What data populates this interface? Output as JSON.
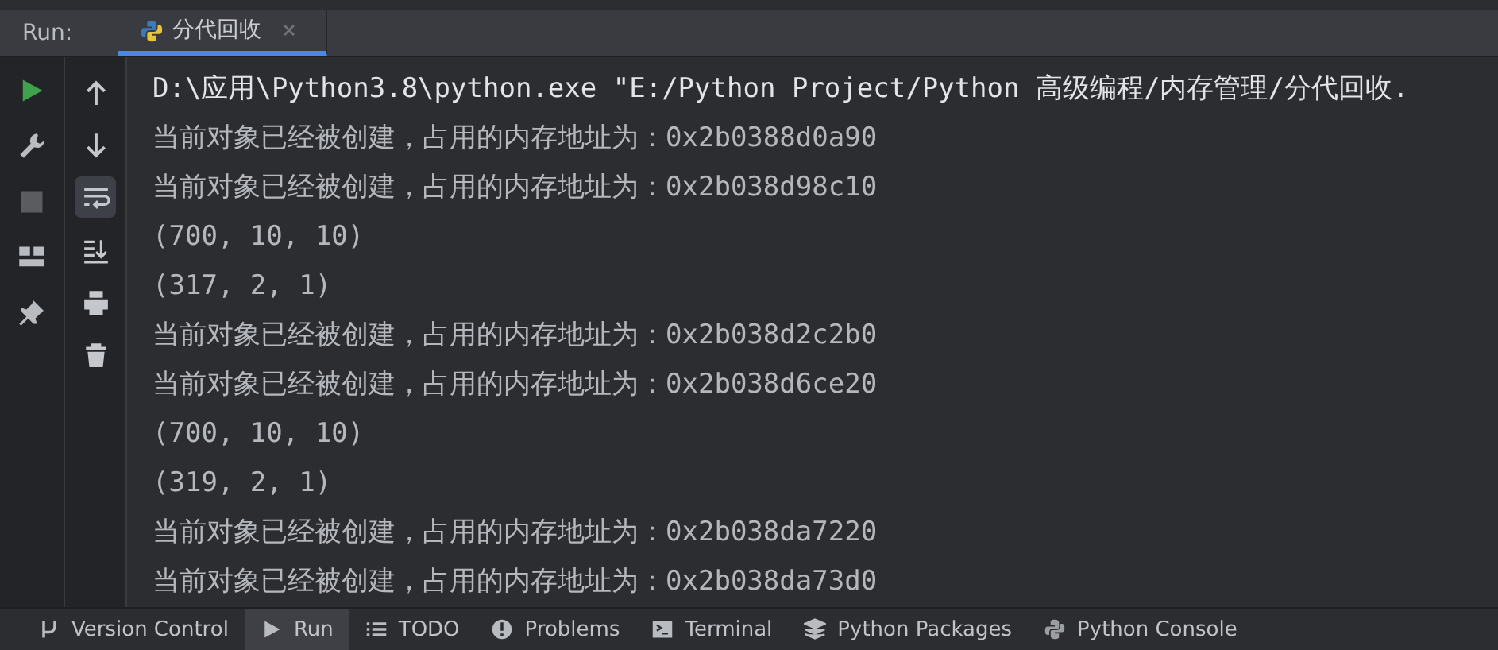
{
  "run_bar": {
    "label": "Run:",
    "tabs": [
      {
        "title": "分代回收",
        "selected": true
      }
    ]
  },
  "tools_left": [
    {
      "kind": "run",
      "disabled": false
    },
    {
      "kind": "wrench",
      "disabled": false
    },
    {
      "kind": "stop",
      "disabled": true
    },
    {
      "kind": "layout",
      "disabled": false
    },
    {
      "kind": "pin",
      "disabled": false
    }
  ],
  "tools_right": [
    {
      "kind": "up",
      "on": false
    },
    {
      "kind": "down",
      "on": false
    },
    {
      "kind": "wrap",
      "on": true
    },
    {
      "kind": "scroll-end",
      "on": false
    },
    {
      "kind": "print",
      "on": false
    },
    {
      "kind": "trash",
      "on": false
    }
  ],
  "console": [
    {
      "kind": "command",
      "text": "D:\\应用\\Python3.8\\python.exe \"E:/Python Project/Python 高级编程/内存管理/分代回收."
    },
    {
      "kind": "output",
      "text": "当前对象已经被创建，占用的内存地址为：0x2b0388d0a90"
    },
    {
      "kind": "output",
      "text": "当前对象已经被创建，占用的内存地址为：0x2b038d98c10"
    },
    {
      "kind": "output",
      "text": "(700, 10, 10)"
    },
    {
      "kind": "output",
      "text": "(317, 2, 1)"
    },
    {
      "kind": "output",
      "text": "当前对象已经被创建，占用的内存地址为：0x2b038d2c2b0"
    },
    {
      "kind": "output",
      "text": "当前对象已经被创建，占用的内存地址为：0x2b038d6ce20"
    },
    {
      "kind": "output",
      "text": "(700, 10, 10)"
    },
    {
      "kind": "output",
      "text": "(319, 2, 1)"
    },
    {
      "kind": "output",
      "text": "当前对象已经被创建，占用的内存地址为：0x2b038da7220"
    },
    {
      "kind": "output",
      "text": "当前对象已经被创建，占用的内存地址为：0x2b038da73d0"
    }
  ],
  "bottom_bar": [
    {
      "kind": "vcs",
      "label": "Version Control",
      "selected": false
    },
    {
      "kind": "run",
      "label": "Run",
      "selected": true
    },
    {
      "kind": "todo",
      "label": "TODO",
      "selected": false
    },
    {
      "kind": "problems",
      "label": "Problems",
      "selected": false
    },
    {
      "kind": "terminal",
      "label": "Terminal",
      "selected": false
    },
    {
      "kind": "packages",
      "label": "Python Packages",
      "selected": false
    },
    {
      "kind": "console",
      "label": "Python Console",
      "selected": false
    }
  ]
}
